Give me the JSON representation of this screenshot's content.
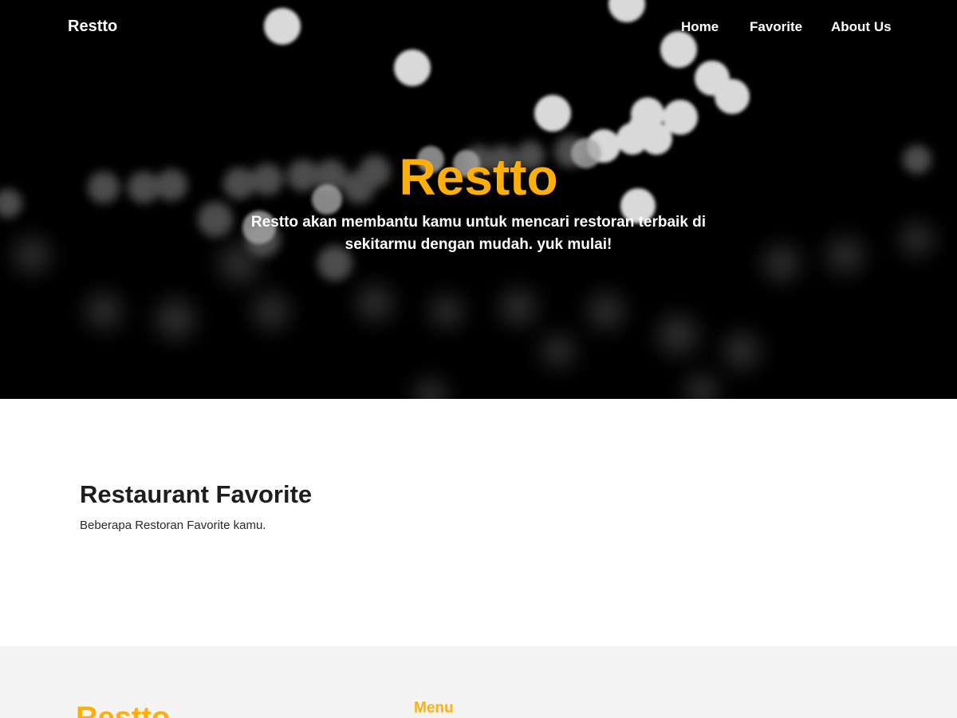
{
  "navbar": {
    "brand": "Restto",
    "links": [
      {
        "label": "Home"
      },
      {
        "label": "Favorite"
      },
      {
        "label": "About Us"
      }
    ]
  },
  "hero": {
    "title": "Restto",
    "subtitle": "Restto akan membantu kamu untuk mencari restoran terbaik di sekitarmu dengan mudah. yuk mulai!"
  },
  "favorite": {
    "title": "Restaurant Favorite",
    "description": "Beberapa Restoran Favorite kamu."
  },
  "footer": {
    "brand": "Restto",
    "menu_title": "Menu"
  },
  "colors": {
    "accent": "#FFAF08",
    "hero_background": "#000000",
    "footer_background": "#F4F4F4"
  }
}
